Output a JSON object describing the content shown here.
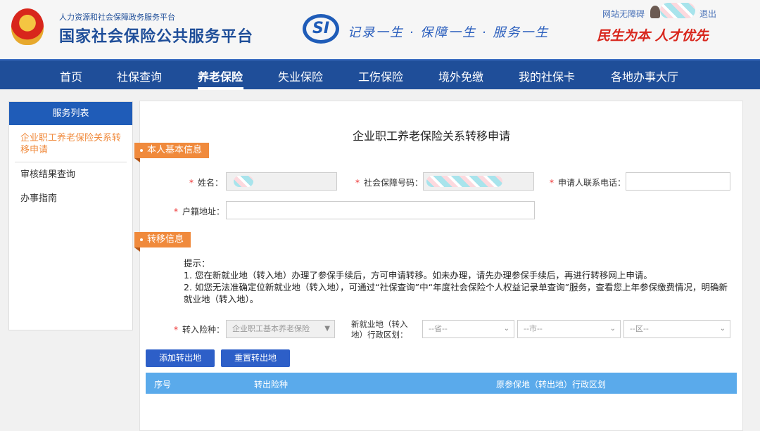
{
  "header": {
    "subtitle": "人力资源和社会保障政务服务平台",
    "title": "国家社会保险公共服务平台",
    "logo_text": "SI",
    "slogan": "记录一生 · 保障一生 · 服务一生",
    "motto": "民生为本 人才优先",
    "accessibility": "网站无障碍",
    "logout": "退出"
  },
  "nav": [
    "首页",
    "社保查询",
    "养老保险",
    "失业保险",
    "工伤保险",
    "境外免缴",
    "我的社保卡",
    "各地办事大厅"
  ],
  "sidebar": {
    "title": "服务列表",
    "items": [
      "企业职工养老保险关系转移申请",
      "审核结果查询",
      "办事指南"
    ]
  },
  "page": {
    "title": "企业职工养老保险关系转移申请",
    "section1": "本人基本信息",
    "name_label": "姓名：",
    "ssn_label": "社会保障号码：",
    "phone_label": "申请人联系电话：",
    "address_label": "户籍地址：",
    "section2": "转移信息",
    "tips_title": "提示：",
    "tip1": "1. 您在新就业地（转入地）办理了参保手续后，方可申请转移。如未办理，请先办理参保手续后，再进行转移网上申请。",
    "tip2": "2. 如您无法准确定位新就业地（转入地），可通过“社保查询”中“年度社会保险个人权益记录单查询”服务，查看您上年参保缴费情况，明确新就业地（转入地）。",
    "insurance_label": "转入险种：",
    "insurance_value": "企业职工基本养老保险",
    "region_label_1": "新就业地（转入",
    "region_label_2": "地）行政区划：",
    "province": "--省--",
    "city": "--市--",
    "district": "--区--",
    "add_button": "添加转出地",
    "reset_button": "重置转出地",
    "columns": [
      "序号",
      "转出险种",
      "原参保地（转出地）行政区划"
    ]
  }
}
